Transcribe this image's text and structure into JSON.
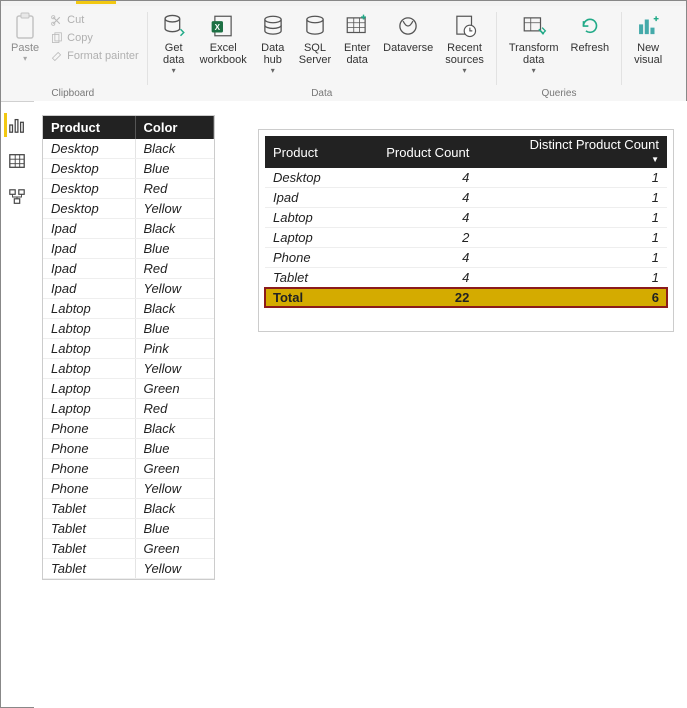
{
  "ribbon": {
    "groups": {
      "clipboard": {
        "label": "Clipboard",
        "paste": "Paste",
        "cut": "Cut",
        "copy": "Copy",
        "format_painter": "Format painter"
      },
      "data": {
        "label": "Data",
        "get_data": "Get\ndata",
        "excel": "Excel\nworkbook",
        "data_hub": "Data\nhub",
        "sql": "SQL\nServer",
        "enter": "Enter\ndata",
        "dataverse": "Dataverse",
        "recent": "Recent\nsources"
      },
      "queries": {
        "label": "Queries",
        "transform": "Transform\ndata",
        "refresh": "Refresh"
      },
      "insert": {
        "new_visual": "New\nvisual"
      }
    }
  },
  "chart_data": [
    {
      "type": "table",
      "columns": [
        "Product",
        "Color"
      ],
      "rows": [
        [
          "Desktop",
          "Black"
        ],
        [
          "Desktop",
          "Blue"
        ],
        [
          "Desktop",
          "Red"
        ],
        [
          "Desktop",
          "Yellow"
        ],
        [
          "Ipad",
          "Black"
        ],
        [
          "Ipad",
          "Blue"
        ],
        [
          "Ipad",
          "Red"
        ],
        [
          "Ipad",
          "Yellow"
        ],
        [
          "Labtop",
          "Black"
        ],
        [
          "Labtop",
          "Blue"
        ],
        [
          "Labtop",
          "Pink"
        ],
        [
          "Labtop",
          "Yellow"
        ],
        [
          "Laptop",
          "Green"
        ],
        [
          "Laptop",
          "Red"
        ],
        [
          "Phone",
          "Black"
        ],
        [
          "Phone",
          "Blue"
        ],
        [
          "Phone",
          "Green"
        ],
        [
          "Phone",
          "Yellow"
        ],
        [
          "Tablet",
          "Black"
        ],
        [
          "Tablet",
          "Blue"
        ],
        [
          "Tablet",
          "Green"
        ],
        [
          "Tablet",
          "Yellow"
        ]
      ]
    },
    {
      "type": "table",
      "columns": [
        "Product",
        "Product Count",
        "Distinct Product Count"
      ],
      "rows": [
        [
          "Desktop",
          4,
          1
        ],
        [
          "Ipad",
          4,
          1
        ],
        [
          "Labtop",
          4,
          1
        ],
        [
          "Laptop",
          2,
          1
        ],
        [
          "Phone",
          4,
          1
        ],
        [
          "Tablet",
          4,
          1
        ]
      ],
      "total_row": [
        "Total",
        22,
        6
      ]
    }
  ]
}
